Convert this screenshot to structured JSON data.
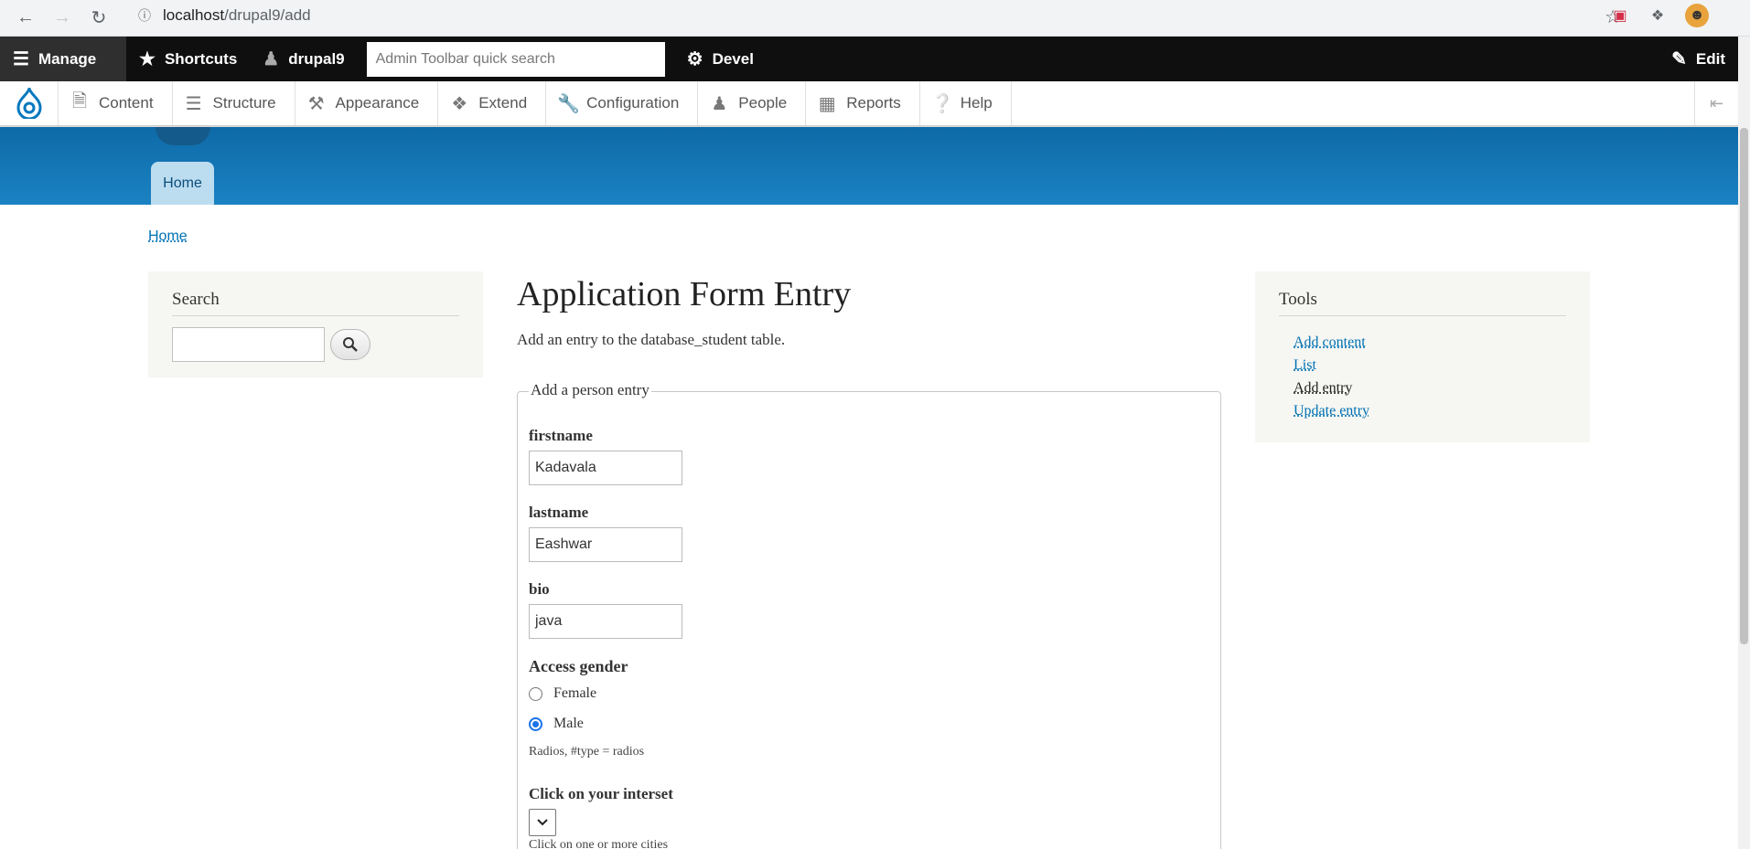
{
  "browser": {
    "url_host": "localhost",
    "url_path": "/drupal9/add"
  },
  "toolbar": {
    "manage": "Manage",
    "shortcuts": "Shortcuts",
    "user": "drupal9",
    "search_placeholder": "Admin Toolbar quick search",
    "devel": "Devel",
    "edit": "Edit"
  },
  "tray": {
    "items": [
      {
        "label": "Content",
        "icon": "document-icon"
      },
      {
        "label": "Structure",
        "icon": "sitemap-icon"
      },
      {
        "label": "Appearance",
        "icon": "paintbrush-icon"
      },
      {
        "label": "Extend",
        "icon": "puzzle-icon"
      },
      {
        "label": "Configuration",
        "icon": "wrench-icon"
      },
      {
        "label": "People",
        "icon": "person-icon"
      },
      {
        "label": "Reports",
        "icon": "bar-chart-icon"
      },
      {
        "label": "Help",
        "icon": "help-icon"
      }
    ]
  },
  "header": {
    "home_tab": "Home"
  },
  "breadcrumb": "Home",
  "search_block": {
    "title": "Search"
  },
  "main": {
    "title": "Application Form Entry",
    "description": "Add an entry to the database_student table.",
    "fieldset_legend": "Add a person entry",
    "firstname_label": "firstname",
    "firstname_value": "Kadavala",
    "lastname_label": "lastname",
    "lastname_value": "Eashwar",
    "bio_label": "bio",
    "bio_value": "java",
    "gender_label": "Access gender",
    "gender_options": [
      "Female",
      "Male"
    ],
    "gender_selected": "Male",
    "gender_help": "Radios, #type = radios",
    "interest_label": "Click on your interset",
    "interest_help": "Click on one or more cities"
  },
  "tools_block": {
    "title": "Tools",
    "links": [
      "Add content",
      "List",
      "Add entry",
      "Update entry"
    ],
    "active": "Add entry"
  },
  "colors": {
    "toolbar_bg": "#0f0f0f",
    "header_blue": "#1b82c3",
    "link": "#0071b3",
    "radio_accent": "#1a73e8"
  }
}
